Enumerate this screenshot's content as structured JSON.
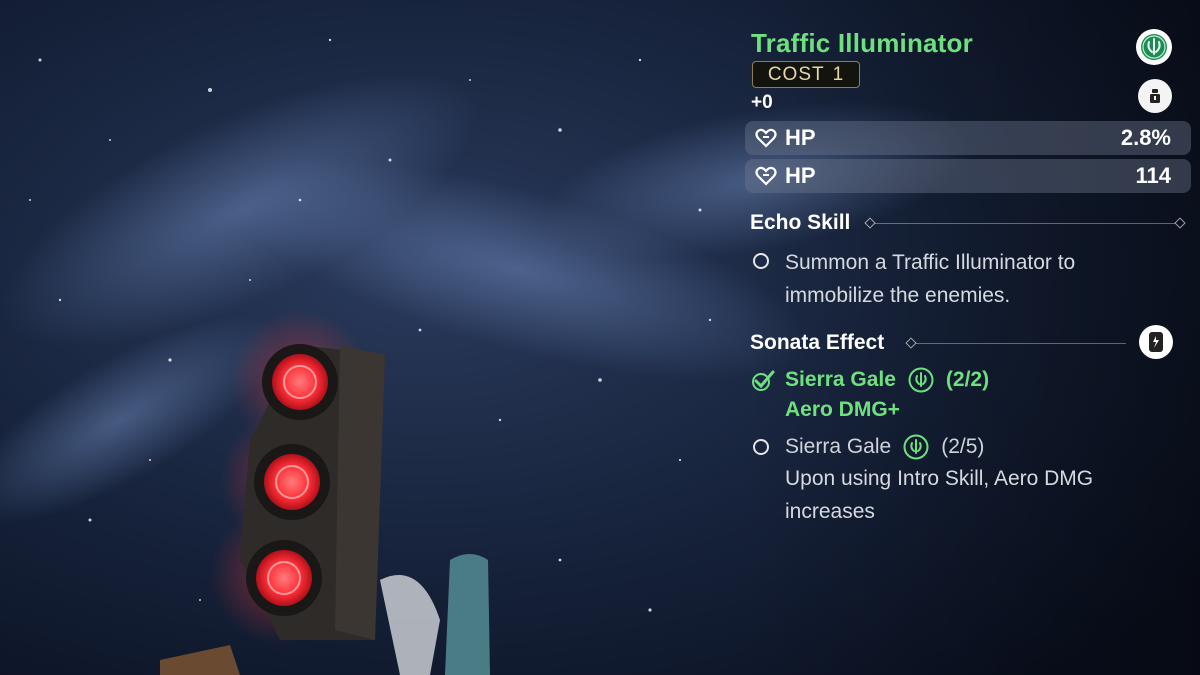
{
  "echo": {
    "name": "Traffic Illuminator",
    "cost_label": "COST",
    "cost_value": "1",
    "level": "+0",
    "stats": [
      {
        "name": "HP",
        "value": "2.8%",
        "icon": "heart-icon"
      },
      {
        "name": "HP",
        "value": "114",
        "icon": "heart-icon"
      }
    ]
  },
  "echo_skill": {
    "heading": "Echo Skill",
    "description_line1": "Summon a Traffic Illuminator to",
    "description_line2": "immobilize the enemies."
  },
  "sonata": {
    "heading": "Sonata Effect",
    "effects": [
      {
        "set": "Sierra Gale",
        "count": "(2/2)",
        "bonus": "Aero DMG+",
        "active": true
      },
      {
        "set": "Sierra Gale",
        "count": "(2/5)",
        "bonus_line1": "Upon using Intro Skill, Aero DMG",
        "bonus_line2": "increases",
        "active": false
      }
    ]
  },
  "colors": {
    "accent_green": "#6ee07f",
    "cost_gold": "#e7d7a8",
    "traffic_red": "#ff3a3a"
  }
}
